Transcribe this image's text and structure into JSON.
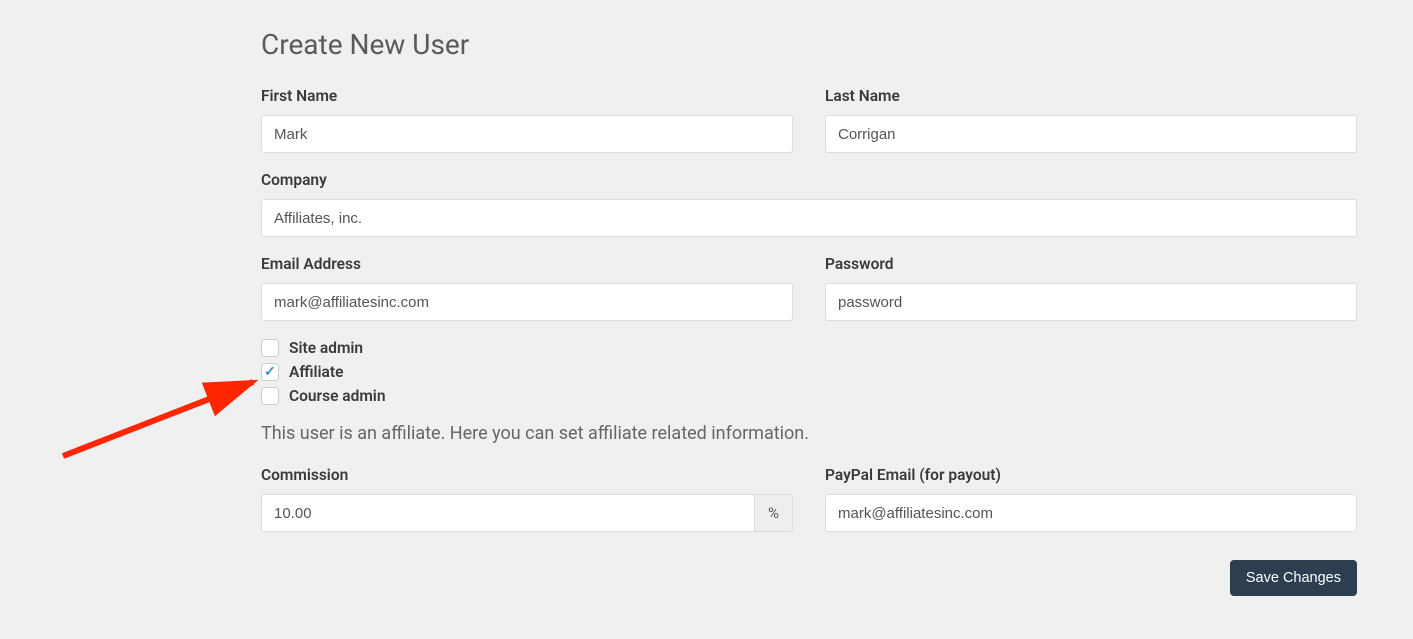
{
  "page": {
    "title": "Create New User"
  },
  "fields": {
    "first_name": {
      "label": "First Name",
      "value": "Mark"
    },
    "last_name": {
      "label": "Last Name",
      "value": "Corrigan"
    },
    "company": {
      "label": "Company",
      "value": "Affiliates, inc."
    },
    "email": {
      "label": "Email Address",
      "value": "mark@affiliatesinc.com"
    },
    "password": {
      "label": "Password",
      "value": "password"
    },
    "commission": {
      "label": "Commission",
      "value": "10.00",
      "addon": "%"
    },
    "paypal_email": {
      "label": "PayPal Email (for payout)",
      "value": "mark@affiliatesinc.com"
    }
  },
  "roles": {
    "site_admin": {
      "label": "Site admin",
      "checked": false
    },
    "affiliate": {
      "label": "Affiliate",
      "checked": true
    },
    "course_admin": {
      "label": "Course admin",
      "checked": false
    }
  },
  "affiliate_info_text": "This user is an affiliate. Here you can set affiliate related information.",
  "buttons": {
    "save": "Save Changes"
  }
}
